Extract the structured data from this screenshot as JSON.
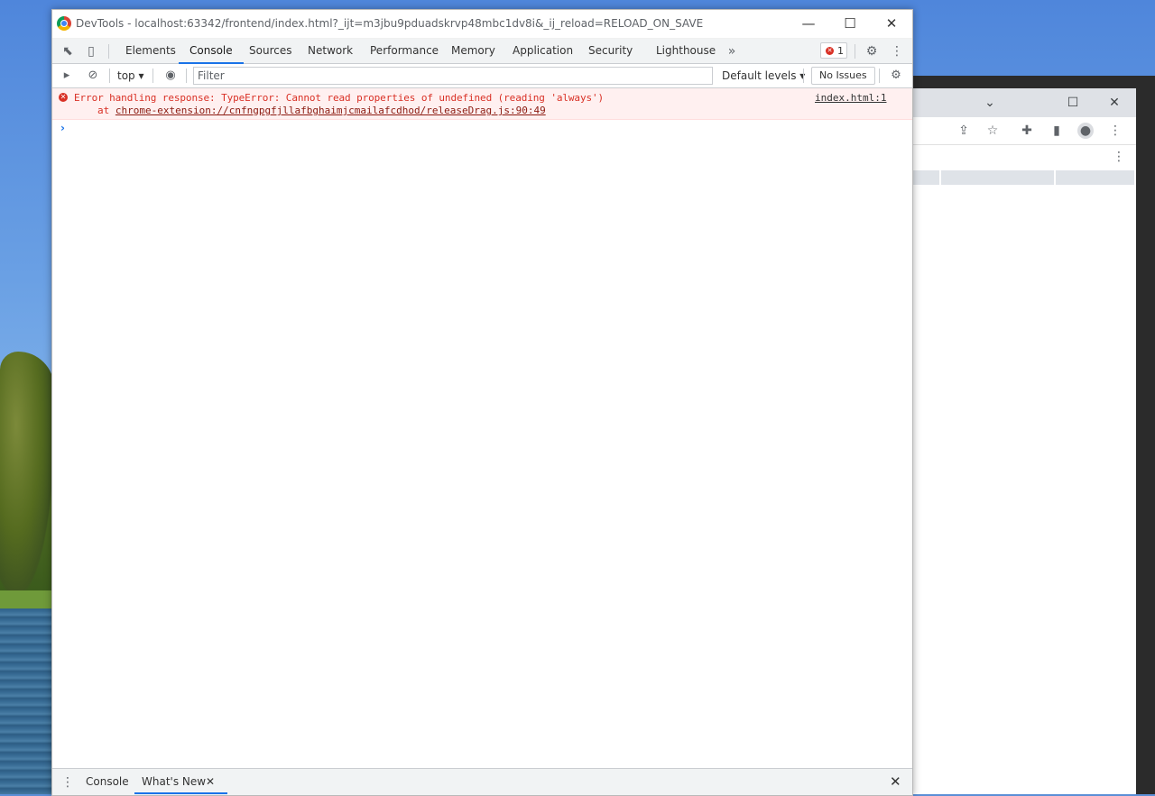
{
  "window": {
    "title": "DevTools - localhost:63342/frontend/index.html?_ijt=m3jbu9pduadskrvp48mbc1dv8i&_ij_reload=RELOAD_ON_SAVE"
  },
  "tabs": [
    {
      "label": "Elements"
    },
    {
      "label": "Console"
    },
    {
      "label": "Sources"
    },
    {
      "label": "Network"
    },
    {
      "label": "Performance"
    },
    {
      "label": "Memory"
    },
    {
      "label": "Application"
    },
    {
      "label": "Security"
    },
    {
      "label": "Lighthouse"
    }
  ],
  "error_badge": {
    "count": "1"
  },
  "console_toolbar": {
    "context": "top",
    "filter_placeholder": "Filter",
    "levels": "Default levels",
    "issues": "No Issues"
  },
  "messages": [
    {
      "text": "Error handling response: TypeError: Cannot read properties of undefined (reading 'always')",
      "at": "at",
      "link": "chrome-extension://cnfngpgfjllafbghaimjcmailafcdhod/releaseDrag.js:90:49",
      "source": "index.html:1"
    }
  ],
  "drawer": {
    "tabs": [
      {
        "label": "Console"
      },
      {
        "label": "What's New"
      }
    ]
  },
  "colors": {
    "accent": "#1a73e8",
    "error": "#d93025",
    "error_bg": "#fff0f0"
  }
}
